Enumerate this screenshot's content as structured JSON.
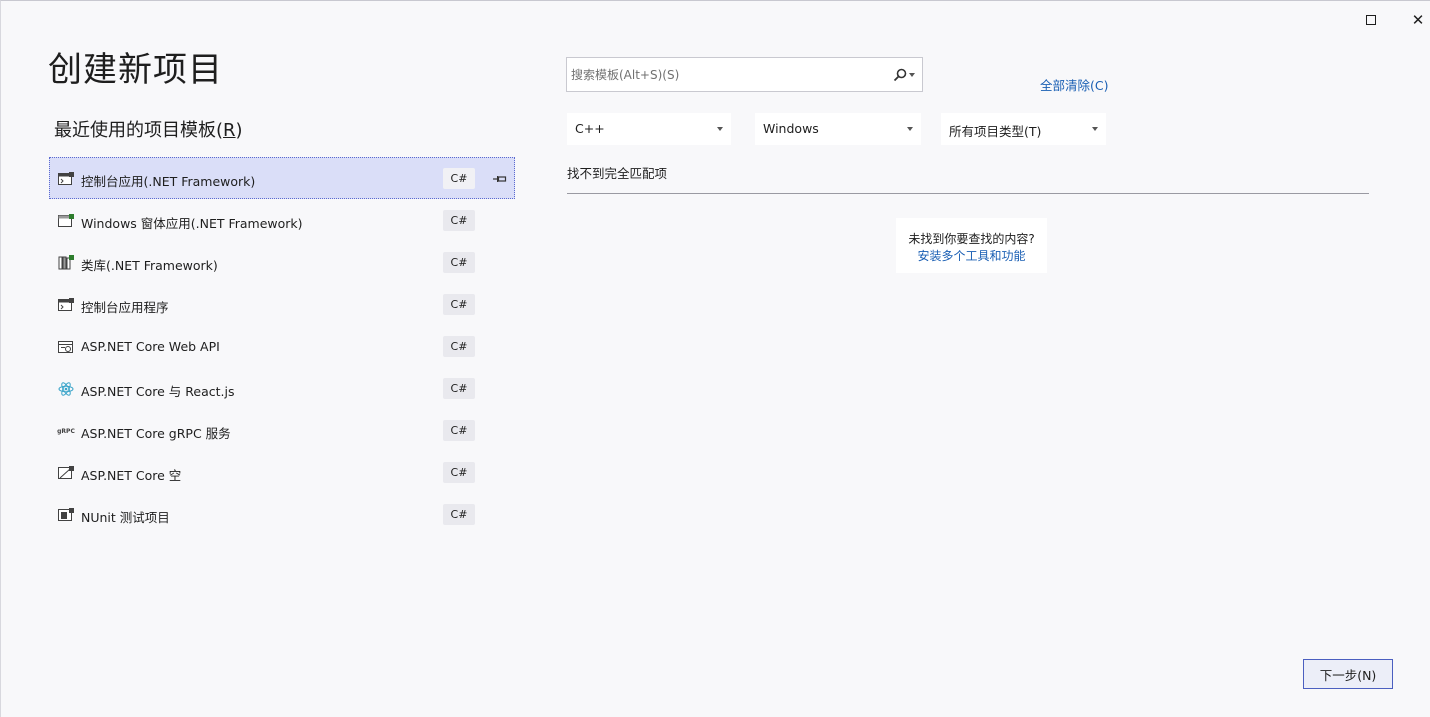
{
  "window": {
    "maximize_icon": "maximize-icon",
    "close_icon": "close-icon",
    "close_glyph": "✕"
  },
  "header": {
    "title": "创建新项目",
    "recent_label": "最近使用的项目模板(",
    "recent_accesskey": "R",
    "recent_suffix": ")"
  },
  "recent_templates": [
    {
      "name": "控制台应用(.NET Framework)",
      "lang": "C#",
      "icon": "console-app-icon",
      "selected": true,
      "pinned": true
    },
    {
      "name": "Windows 窗体应用(.NET Framework)",
      "lang": "C#",
      "icon": "windows-form-icon"
    },
    {
      "name": "类库(.NET Framework)",
      "lang": "C#",
      "icon": "class-library-icon"
    },
    {
      "name": "控制台应用程序",
      "lang": "C#",
      "icon": "console-app-icon"
    },
    {
      "name": "ASP.NET Core Web API",
      "lang": "C#",
      "icon": "web-api-icon"
    },
    {
      "name": "ASP.NET Core 与 React.js",
      "lang": "C#",
      "icon": "react-icon"
    },
    {
      "name": "ASP.NET Core gRPC 服务",
      "lang": "C#",
      "icon": "grpc-icon",
      "icon_text": "gRPC"
    },
    {
      "name": "ASP.NET Core 空",
      "lang": "C#",
      "icon": "empty-web-icon"
    },
    {
      "name": "NUnit 测试项目",
      "lang": "C#",
      "icon": "test-project-icon"
    }
  ],
  "search": {
    "placeholder": "搜索模板(Alt+S)(S)",
    "value": ""
  },
  "clear_all": "全部清除(C)",
  "filters": {
    "language": "C++",
    "platform": "Windows",
    "project_type": "所有项目类型(T)"
  },
  "results": {
    "no_match": "找不到完全匹配项",
    "help_question": "未找到你要查找的内容?",
    "help_link": "安装多个工具和功能"
  },
  "footer": {
    "next_label": "下一步(N)"
  },
  "colors": {
    "accent": "#5b6ad0",
    "link": "#1a5fb4",
    "selected_bg": "#dadef8",
    "background": "#f8f8fa"
  }
}
